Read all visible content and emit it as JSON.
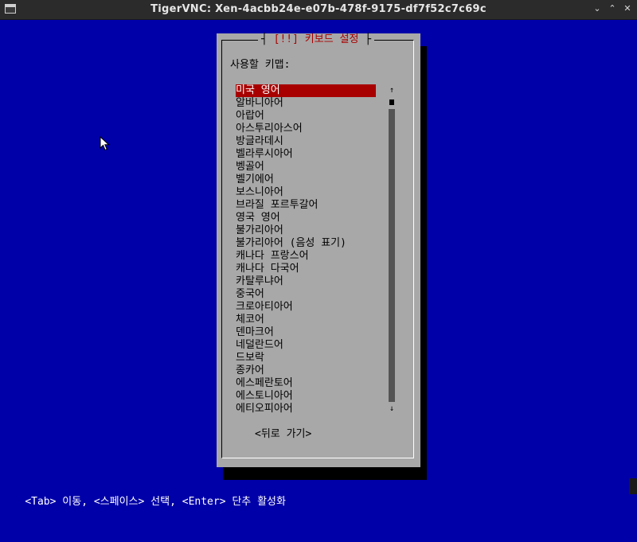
{
  "window": {
    "title": "TigerVNC: Xen-4acbb24e-e07b-478f-9175-df7f52c7c69c",
    "controls": {
      "minimize": "⌄",
      "maximize": "⌃",
      "close": "✕"
    }
  },
  "dialog": {
    "title_open": "┤ ",
    "title": "[!!] 키보드 설정",
    "title_close": " ├",
    "prompt": "사용할 키맵:",
    "items": [
      "미국 영어",
      "알바니아어",
      "아랍어",
      "아스투리아스어",
      "방글라데시",
      "벨라루시아어",
      "벵골어",
      "벨기에어",
      "보스니아어",
      "브라질 포르투갈어",
      "영국 영어",
      "불가리아어",
      "불가리아어 (음성 표기)",
      "캐나다 프랑스어",
      "캐나다 다국어",
      "카탈루냐어",
      "중국어",
      "크로아티아어",
      "체코어",
      "덴마크어",
      "네덜란드어",
      "드보락",
      "종카어",
      "에스페란토어",
      "에스토니아어",
      "에티오피아어"
    ],
    "selected_index": 0,
    "scroll": {
      "up_arrow": "↑",
      "down_arrow": "↓"
    },
    "back_button": "<뒤로 가기>"
  },
  "statusbar": {
    "help": "<Tab> 이동, <스페이스> 선택, <Enter> 단추 활성화"
  },
  "colors": {
    "background": "#0000a8",
    "dialog": "#a8a8a8",
    "highlight": "#a80000",
    "shadow": "#000000"
  }
}
